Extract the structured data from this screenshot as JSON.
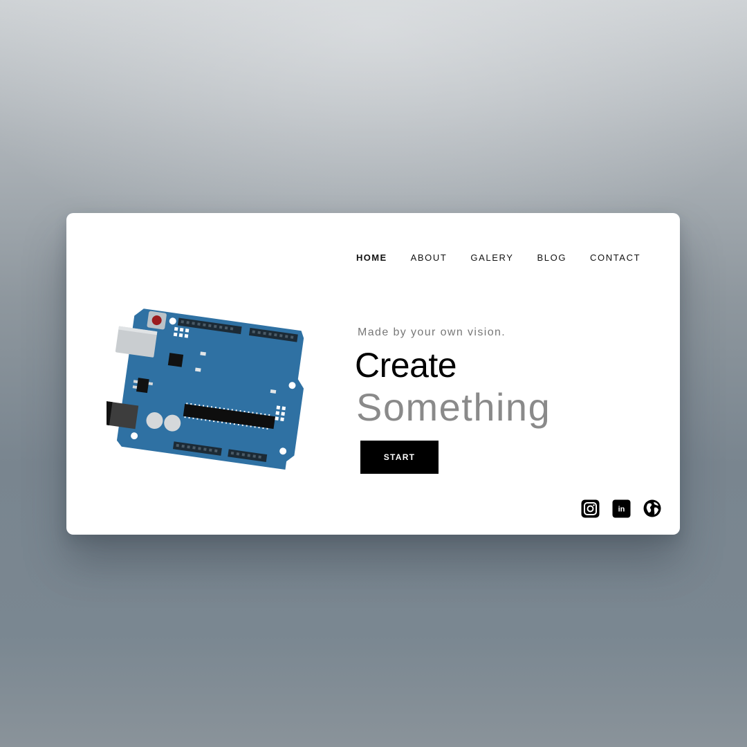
{
  "nav": {
    "items": [
      {
        "label": "HOME",
        "active": true
      },
      {
        "label": "ABOUT",
        "active": false
      },
      {
        "label": "GALERY",
        "active": false
      },
      {
        "label": "BLOG",
        "active": false
      },
      {
        "label": "CONTACT",
        "active": false
      }
    ]
  },
  "hero": {
    "tagline": "Made by your own vision.",
    "title_line1": "Create",
    "title_line2": "Something",
    "cta_label": "START",
    "illustration": "arduino-board"
  },
  "social": {
    "icons": [
      "instagram-icon",
      "linkedin-icon",
      "globe-icon"
    ],
    "linkedin_glyph": "in"
  },
  "colors": {
    "board_blue": "#2f71a3",
    "text_primary": "#000000",
    "text_secondary": "#8a8a8a",
    "button_bg": "#000000",
    "card_bg": "#ffffff"
  }
}
